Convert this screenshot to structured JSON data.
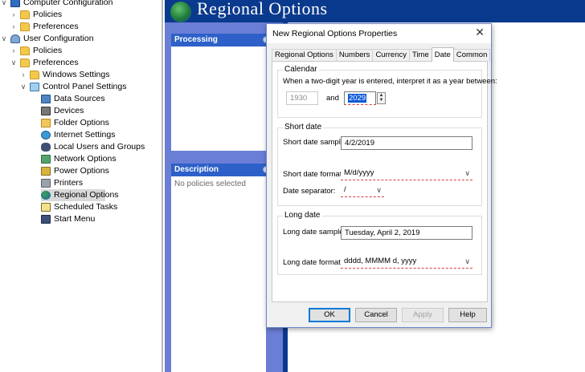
{
  "tree": {
    "items": [
      {
        "label": "Computer Configuration",
        "icon": "computer-icon",
        "indent": 0,
        "chevron": "∨"
      },
      {
        "label": "Policies",
        "icon": "folder-icon",
        "indent": 1,
        "chevron": "›"
      },
      {
        "label": "Preferences",
        "icon": "folder-icon",
        "indent": 1,
        "chevron": "›"
      },
      {
        "label": "User Configuration",
        "icon": "user-icon",
        "indent": 0,
        "chevron": "∨"
      },
      {
        "label": "Policies",
        "icon": "folder-icon",
        "indent": 1,
        "chevron": "›"
      },
      {
        "label": "Preferences",
        "icon": "folder-icon",
        "indent": 1,
        "chevron": "∨"
      },
      {
        "label": "Windows Settings",
        "icon": "folder-icon",
        "indent": 2,
        "chevron": "›"
      },
      {
        "label": "Control Panel Settings",
        "icon": "control-panel-icon",
        "indent": 2,
        "chevron": "∨"
      },
      {
        "label": "Data Sources",
        "icon": "data-sources-icon",
        "indent": 3,
        "chevron": ""
      },
      {
        "label": "Devices",
        "icon": "devices-icon",
        "indent": 3,
        "chevron": ""
      },
      {
        "label": "Folder Options",
        "icon": "folder-options-icon",
        "indent": 3,
        "chevron": ""
      },
      {
        "label": "Internet Settings",
        "icon": "internet-icon",
        "indent": 3,
        "chevron": ""
      },
      {
        "label": "Local Users and Groups",
        "icon": "users-groups-icon",
        "indent": 3,
        "chevron": ""
      },
      {
        "label": "Network Options",
        "icon": "network-icon",
        "indent": 3,
        "chevron": ""
      },
      {
        "label": "Power Options",
        "icon": "power-icon",
        "indent": 3,
        "chevron": ""
      },
      {
        "label": "Printers",
        "icon": "printer-icon",
        "indent": 3,
        "chevron": ""
      },
      {
        "label": "Regional Options",
        "icon": "globe-icon",
        "indent": 3,
        "chevron": "",
        "selected": true
      },
      {
        "label": "Scheduled Tasks",
        "icon": "scheduled-tasks-icon",
        "indent": 3,
        "chevron": ""
      },
      {
        "label": "Start Menu",
        "icon": "start-menu-icon",
        "indent": 3,
        "chevron": ""
      }
    ]
  },
  "banner": {
    "title": "Regional Options",
    "icon": "globe-icon"
  },
  "sidebar": {
    "processing_title": "Processing",
    "description_title": "Description",
    "description_text": "No policies selected"
  },
  "dialog": {
    "title": "New Regional Options Properties",
    "close": "✕",
    "tabs": [
      "Regional Options",
      "Numbers",
      "Currency",
      "Time",
      "Date",
      "Common"
    ],
    "active_tab": "Date",
    "calendar": {
      "group_label": "Calendar",
      "prompt": "When a two-digit year is entered, interpret it as a year between:",
      "from_year": "1930",
      "and_label": "and",
      "to_year": "2029"
    },
    "short_date": {
      "group_label": "Short date",
      "sample_label": "Short date sample:",
      "sample_value": "4/2/2019",
      "format_label": "Short date format:",
      "format_value": "M/d/yyyy",
      "separator_label": "Date separator:",
      "separator_value": "/"
    },
    "long_date": {
      "group_label": "Long date",
      "sample_label": "Long date sample:",
      "sample_value": "Tuesday, April 2, 2019",
      "format_label": "Long date format:",
      "format_value": "dddd, MMMM d, yyyy"
    },
    "buttons": {
      "ok": "OK",
      "cancel": "Cancel",
      "apply": "Apply",
      "help": "Help"
    }
  },
  "colors": {
    "banner": "#0a3a8d",
    "sidebar": "#6b7ed6",
    "panel_header": "#2d61c9",
    "selection": "#0a58d8"
  }
}
